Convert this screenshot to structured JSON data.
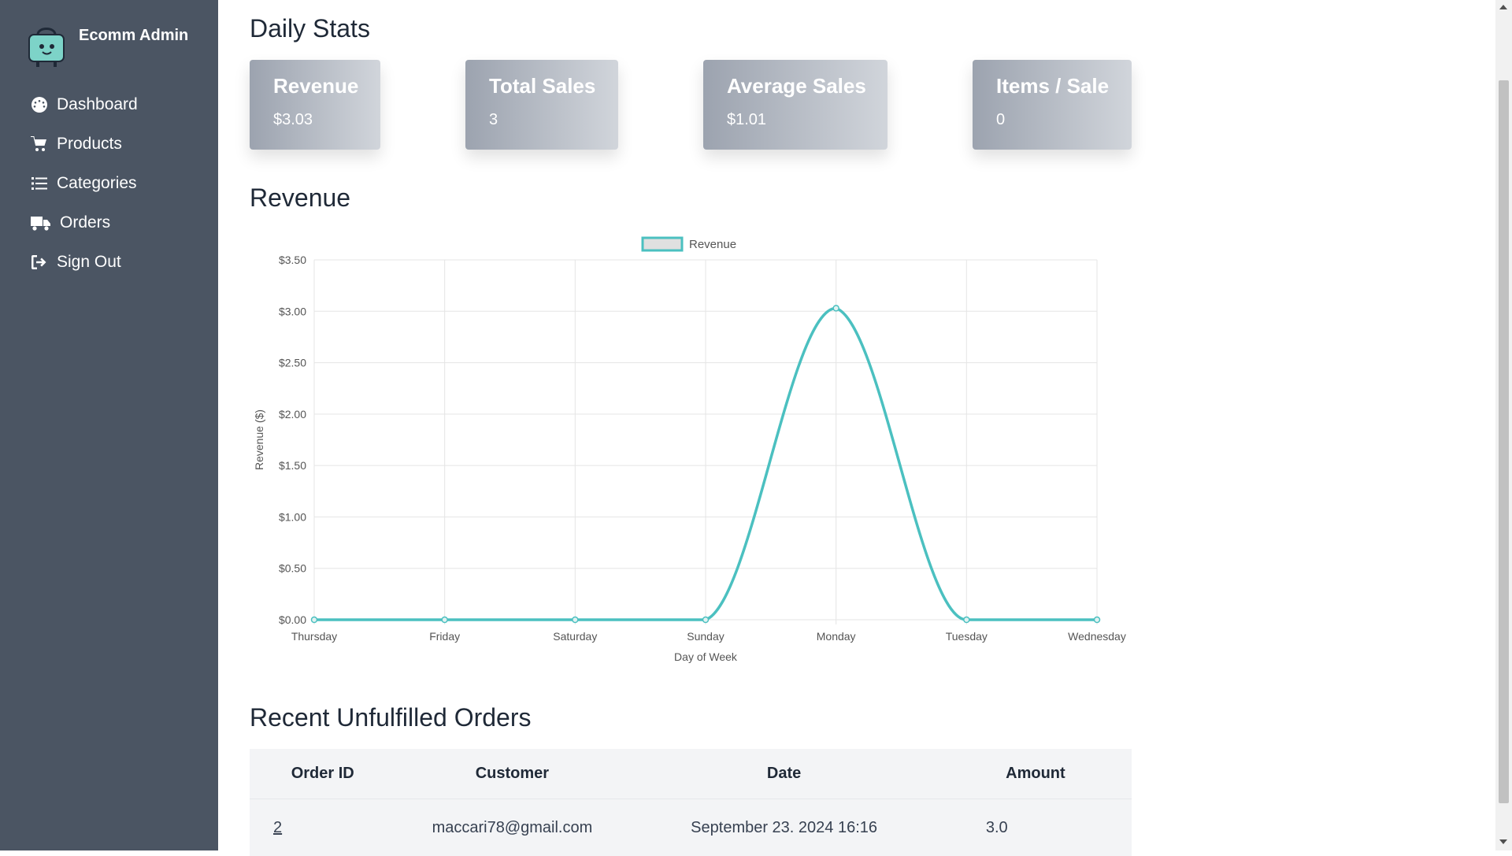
{
  "app": {
    "title": "Ecomm Admin"
  },
  "sidebar": {
    "items": [
      {
        "label": "Dashboard",
        "icon": "dashboard-icon"
      },
      {
        "label": "Products",
        "icon": "cart-icon"
      },
      {
        "label": "Categories",
        "icon": "list-icon"
      },
      {
        "label": "Orders",
        "icon": "truck-icon"
      },
      {
        "label": "Sign Out",
        "icon": "sign-out-icon"
      }
    ]
  },
  "stats": {
    "title": "Daily Stats",
    "cards": [
      {
        "title": "Revenue",
        "value": "$3.03"
      },
      {
        "title": "Total Sales",
        "value": "3"
      },
      {
        "title": "Average Sales",
        "value": "$1.01"
      },
      {
        "title": "Items / Sale",
        "value": "0"
      }
    ]
  },
  "revenue_section": {
    "title": "Revenue"
  },
  "chart_data": {
    "type": "line",
    "categories": [
      "Thursday",
      "Friday",
      "Saturday",
      "Sunday",
      "Monday",
      "Tuesday",
      "Wednesday"
    ],
    "series": [
      {
        "name": "Revenue",
        "values": [
          0,
          0,
          0,
          0,
          3.03,
          0,
          0
        ],
        "color": "#4bc0c0"
      }
    ],
    "xlabel": "Day of Week",
    "ylabel": "Revenue ($)",
    "ylim": [
      0,
      3.5
    ],
    "yticks": [
      "$0.00",
      "$0.50",
      "$1.00",
      "$1.50",
      "$2.00",
      "$2.50",
      "$3.00",
      "$3.50"
    ],
    "grid": true,
    "legend": "top-center"
  },
  "orders": {
    "title": "Recent Unfulfilled Orders",
    "headers": [
      "Order ID",
      "Customer",
      "Date",
      "Amount"
    ],
    "rows": [
      {
        "id": "2",
        "customer": "maccari78@gmail.com",
        "date": "September 23. 2024 16:16",
        "amount": "3.0"
      }
    ]
  },
  "colors": {
    "sidebar": "#4b5563",
    "accent": "#4bc0c0"
  }
}
